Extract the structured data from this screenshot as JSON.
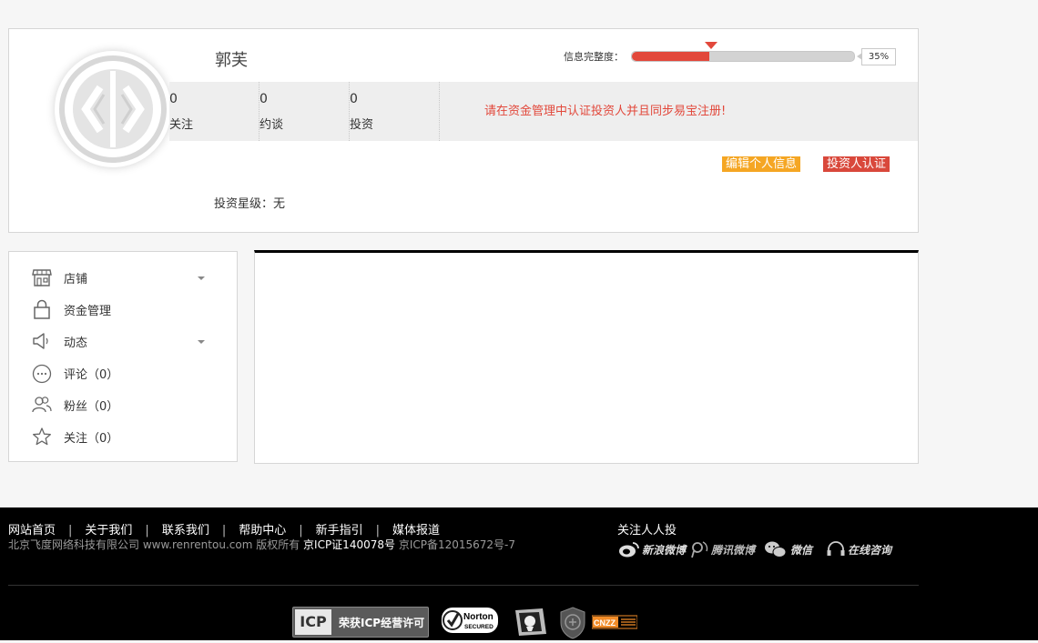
{
  "profile": {
    "name": "郭芙",
    "progress_label": "信息完整度：",
    "progress_percent_text": "35%",
    "progress_value": 0.35,
    "stats": [
      {
        "value": "0",
        "label": "关注"
      },
      {
        "value": "0",
        "label": "约谈"
      },
      {
        "value": "0",
        "label": "投资"
      }
    ],
    "notice": "请在资金管理中认证投资人并且同步易宝注册!",
    "edit_button": "编辑个人信息",
    "verify_button": "投资人认证",
    "star_level": "投资星级：无"
  },
  "menu": {
    "items": [
      {
        "label": "店铺",
        "icon": "store-icon",
        "has_dropdown": true
      },
      {
        "label": "资金管理",
        "icon": "lock-icon",
        "has_dropdown": false
      },
      {
        "label": "动态",
        "icon": "speaker-icon",
        "has_dropdown": true
      },
      {
        "label": "评论（0）",
        "icon": "comment-icon",
        "has_dropdown": false
      },
      {
        "label": "粉丝（0）",
        "icon": "fans-icon",
        "has_dropdown": false
      },
      {
        "label": "关注（0）",
        "icon": "star-icon",
        "has_dropdown": false
      }
    ]
  },
  "footer": {
    "links": [
      "网站首页",
      "关于我们",
      "联系我们",
      "帮助中心",
      "新手指引",
      "媒体报道"
    ],
    "separator": "|",
    "copyright": "北京飞度网络科技有限公司 www.renrentou.com 版权所有",
    "icp_license": "京ICP证140078号",
    "icp_record": "京ICP备12015672号-7",
    "follow_title": "关注人人投",
    "social": [
      "新浪微博",
      "腾讯微博",
      "微信",
      "在线咨询"
    ],
    "badges": {
      "icp_short": "ICP",
      "icp_text": "荣获ICP经营许可",
      "norton": "Norton",
      "norton_sub": "SECURED",
      "cnzz": "CNZZ"
    }
  },
  "colors": {
    "accent_red": "#e2483b",
    "accent_orange": "#f5a623",
    "footer_bg": "#000000"
  }
}
